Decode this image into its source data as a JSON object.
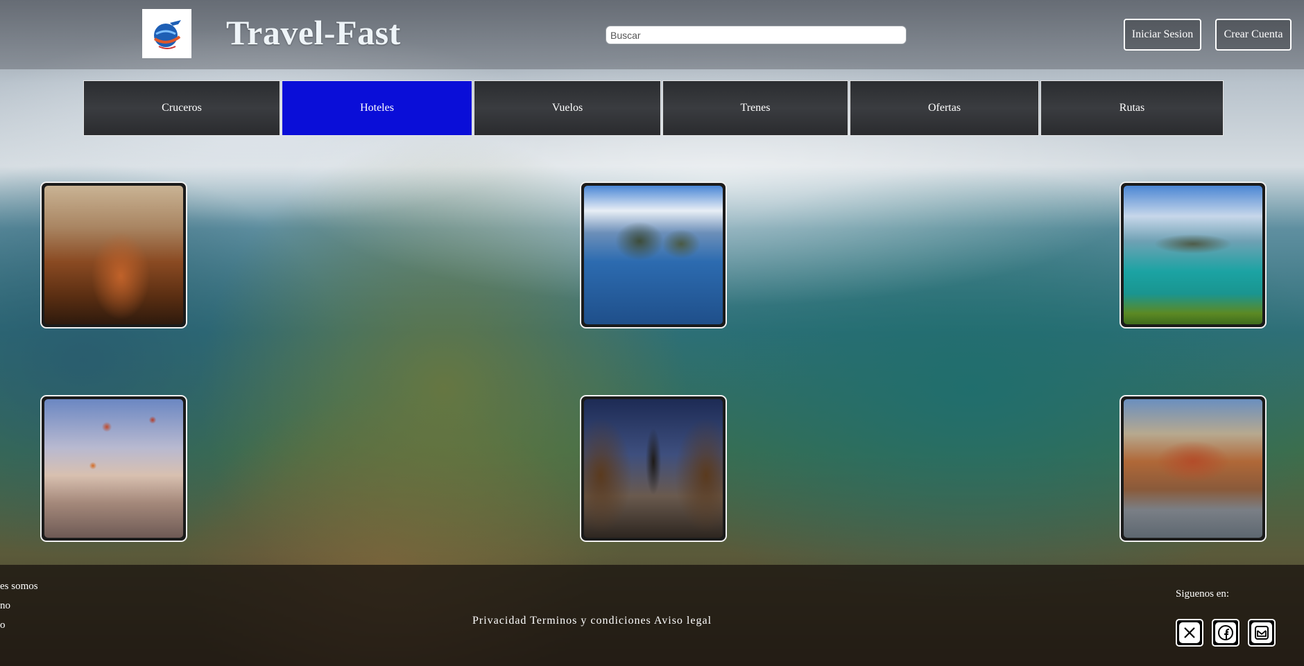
{
  "header": {
    "title": "Travel-Fast",
    "search_placeholder": "Buscar",
    "login_label": "Iniciar Sesion",
    "register_label": "Crear Cuenta"
  },
  "nav": {
    "items": [
      {
        "label": "Cruceros"
      },
      {
        "label": "Hoteles",
        "active": true
      },
      {
        "label": "Vuelos"
      },
      {
        "label": "Trenes"
      },
      {
        "label": "Ofertas"
      },
      {
        "label": "Rutas"
      }
    ],
    "active_color": "#0a0ed8"
  },
  "footer": {
    "links": [
      "es somos",
      "no",
      "o"
    ],
    "legal": {
      "privacy": "Privacidad",
      "terms": "Terminos y condiciones",
      "notice": "Aviso legal"
    },
    "follow_label": "Siguenos en:",
    "social_icons": [
      "x-icon",
      "facebook-icon",
      "mail-icon"
    ]
  }
}
